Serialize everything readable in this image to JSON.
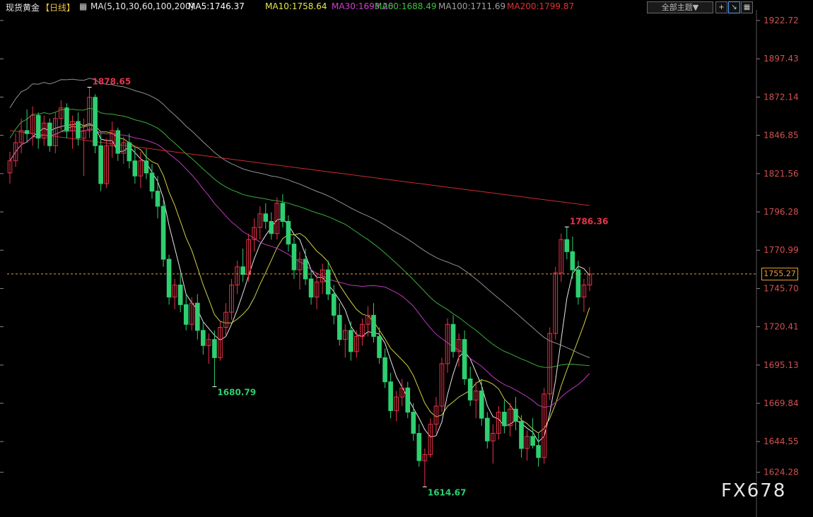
{
  "header": {
    "instrument": "现货黄金",
    "period": "【日线】",
    "ma_params": "MA(5,10,30,60,100,200)",
    "ma5": "MA5:1746.37",
    "ma10": "MA10:1758.64",
    "ma30": "MA30:1693.20",
    "ma60": "MA60:1688.49",
    "ma100": "MA100:1711.69",
    "ma200": "MA200:1799.87"
  },
  "toolbar": {
    "theme_label": "全部主题▼",
    "add_label": "+",
    "zoom_label": "↘",
    "grid_label": "▦"
  },
  "watermark": "FX678",
  "chart_data": {
    "type": "candlestick",
    "title": "现货黄金 日线",
    "ylim": [
      1612,
      1926
    ],
    "y_ticks": [
      1922.72,
      1897.43,
      1872.14,
      1846.85,
      1821.56,
      1796.28,
      1770.99,
      1745.7,
      1720.41,
      1695.13,
      1669.84,
      1644.55,
      1624.28
    ],
    "current_price": 1755.27,
    "annotations": [
      {
        "label": "1878.65",
        "index": 14,
        "value": 1878.65,
        "kind": "high"
      },
      {
        "label": "1680.79",
        "index": 36,
        "value": 1680.79,
        "kind": "low"
      },
      {
        "label": "1786.36",
        "index": 98,
        "value": 1786.36,
        "kind": "high"
      },
      {
        "label": "1614.67",
        "index": 73,
        "value": 1614.67,
        "kind": "low"
      }
    ],
    "series": [
      {
        "name": "MA5",
        "color": "#ffffff"
      },
      {
        "name": "MA10",
        "color": "#e8e84a"
      },
      {
        "name": "MA30",
        "color": "#d040d0"
      },
      {
        "name": "MA60",
        "color": "#40c040"
      },
      {
        "name": "MA100",
        "color": "#a0a0a0"
      },
      {
        "name": "MA200",
        "color": "#e03030"
      }
    ],
    "candles": [
      [
        1822,
        1836,
        1815,
        1830
      ],
      [
        1830,
        1848,
        1826,
        1842
      ],
      [
        1842,
        1858,
        1835,
        1850
      ],
      [
        1850,
        1864,
        1842,
        1848
      ],
      [
        1848,
        1866,
        1840,
        1860
      ],
      [
        1860,
        1862,
        1838,
        1845
      ],
      [
        1845,
        1860,
        1840,
        1855
      ],
      [
        1855,
        1858,
        1836,
        1840
      ],
      [
        1840,
        1862,
        1835,
        1858
      ],
      [
        1858,
        1870,
        1850,
        1865
      ],
      [
        1865,
        1868,
        1845,
        1850
      ],
      [
        1850,
        1860,
        1838,
        1856
      ],
      [
        1856,
        1862,
        1840,
        1845
      ],
      [
        1845,
        1858,
        1820,
        1850
      ],
      [
        1850,
        1878.65,
        1845,
        1872
      ],
      [
        1872,
        1874,
        1835,
        1840
      ],
      [
        1840,
        1848,
        1810,
        1815
      ],
      [
        1815,
        1845,
        1812,
        1840
      ],
      [
        1840,
        1856,
        1832,
        1850
      ],
      [
        1850,
        1852,
        1830,
        1835
      ],
      [
        1835,
        1846,
        1828,
        1842
      ],
      [
        1842,
        1848,
        1825,
        1830
      ],
      [
        1830,
        1840,
        1815,
        1820
      ],
      [
        1820,
        1836,
        1812,
        1830
      ],
      [
        1830,
        1838,
        1818,
        1822
      ],
      [
        1822,
        1828,
        1805,
        1810
      ],
      [
        1810,
        1820,
        1792,
        1800
      ],
      [
        1800,
        1804,
        1760,
        1765
      ],
      [
        1765,
        1768,
        1735,
        1740
      ],
      [
        1740,
        1752,
        1732,
        1748
      ],
      [
        1748,
        1756,
        1730,
        1735
      ],
      [
        1735,
        1742,
        1718,
        1722
      ],
      [
        1722,
        1740,
        1718,
        1736
      ],
      [
        1736,
        1742,
        1712,
        1718
      ],
      [
        1718,
        1724,
        1702,
        1708
      ],
      [
        1708,
        1716,
        1696,
        1712
      ],
      [
        1712,
        1718,
        1680.79,
        1700
      ],
      [
        1700,
        1724,
        1698,
        1720
      ],
      [
        1720,
        1736,
        1714,
        1730
      ],
      [
        1730,
        1752,
        1725,
        1748
      ],
      [
        1748,
        1764,
        1742,
        1760
      ],
      [
        1760,
        1772,
        1750,
        1755
      ],
      [
        1755,
        1782,
        1750,
        1778
      ],
      [
        1778,
        1792,
        1770,
        1786
      ],
      [
        1786,
        1800,
        1778,
        1795
      ],
      [
        1795,
        1802,
        1785,
        1790
      ],
      [
        1790,
        1796,
        1778,
        1782
      ],
      [
        1782,
        1806,
        1778,
        1802
      ],
      [
        1802,
        1808,
        1786,
        1790
      ],
      [
        1790,
        1794,
        1770,
        1775
      ],
      [
        1775,
        1780,
        1752,
        1758
      ],
      [
        1758,
        1770,
        1745,
        1765
      ],
      [
        1765,
        1772,
        1748,
        1752
      ],
      [
        1752,
        1758,
        1735,
        1740
      ],
      [
        1740,
        1756,
        1732,
        1750
      ],
      [
        1750,
        1762,
        1742,
        1758
      ],
      [
        1758,
        1764,
        1738,
        1742
      ],
      [
        1742,
        1748,
        1722,
        1728
      ],
      [
        1728,
        1736,
        1708,
        1712
      ],
      [
        1712,
        1722,
        1700,
        1718
      ],
      [
        1718,
        1724,
        1698,
        1704
      ],
      [
        1704,
        1718,
        1700,
        1714
      ],
      [
        1714,
        1726,
        1708,
        1722
      ],
      [
        1722,
        1734,
        1714,
        1728
      ],
      [
        1728,
        1736,
        1710,
        1714
      ],
      [
        1714,
        1720,
        1696,
        1700
      ],
      [
        1700,
        1706,
        1680,
        1684
      ],
      [
        1684,
        1690,
        1660,
        1665
      ],
      [
        1665,
        1678,
        1658,
        1674
      ],
      [
        1674,
        1686,
        1668,
        1680
      ],
      [
        1680,
        1684,
        1660,
        1664
      ],
      [
        1664,
        1670,
        1645,
        1650
      ],
      [
        1650,
        1656,
        1628,
        1632
      ],
      [
        1632,
        1640,
        1614.67,
        1636
      ],
      [
        1636,
        1660,
        1634,
        1656
      ],
      [
        1656,
        1674,
        1650,
        1668
      ],
      [
        1668,
        1700,
        1664,
        1696
      ],
      [
        1696,
        1726,
        1690,
        1722
      ],
      [
        1722,
        1728,
        1700,
        1704
      ],
      [
        1704,
        1716,
        1694,
        1712
      ],
      [
        1712,
        1718,
        1682,
        1686
      ],
      [
        1686,
        1694,
        1668,
        1672
      ],
      [
        1672,
        1684,
        1660,
        1678
      ],
      [
        1678,
        1686,
        1655,
        1660
      ],
      [
        1660,
        1664,
        1640,
        1645
      ],
      [
        1645,
        1656,
        1630,
        1650
      ],
      [
        1650,
        1668,
        1646,
        1664
      ],
      [
        1664,
        1672,
        1650,
        1655
      ],
      [
        1655,
        1670,
        1648,
        1666
      ],
      [
        1666,
        1674,
        1652,
        1658
      ],
      [
        1658,
        1662,
        1634,
        1640
      ],
      [
        1640,
        1652,
        1632,
        1648
      ],
      [
        1648,
        1660,
        1640,
        1642
      ],
      [
        1642,
        1650,
        1628,
        1634
      ],
      [
        1634,
        1680,
        1630,
        1676
      ],
      [
        1676,
        1720,
        1672,
        1716
      ],
      [
        1716,
        1760,
        1712,
        1756
      ],
      [
        1756,
        1782,
        1750,
        1778
      ],
      [
        1778,
        1786.36,
        1765,
        1770
      ],
      [
        1770,
        1780,
        1752,
        1758
      ],
      [
        1758,
        1764,
        1735,
        1740
      ],
      [
        1740,
        1752,
        1730,
        1748
      ],
      [
        1748,
        1760,
        1744,
        1755.27
      ]
    ]
  }
}
